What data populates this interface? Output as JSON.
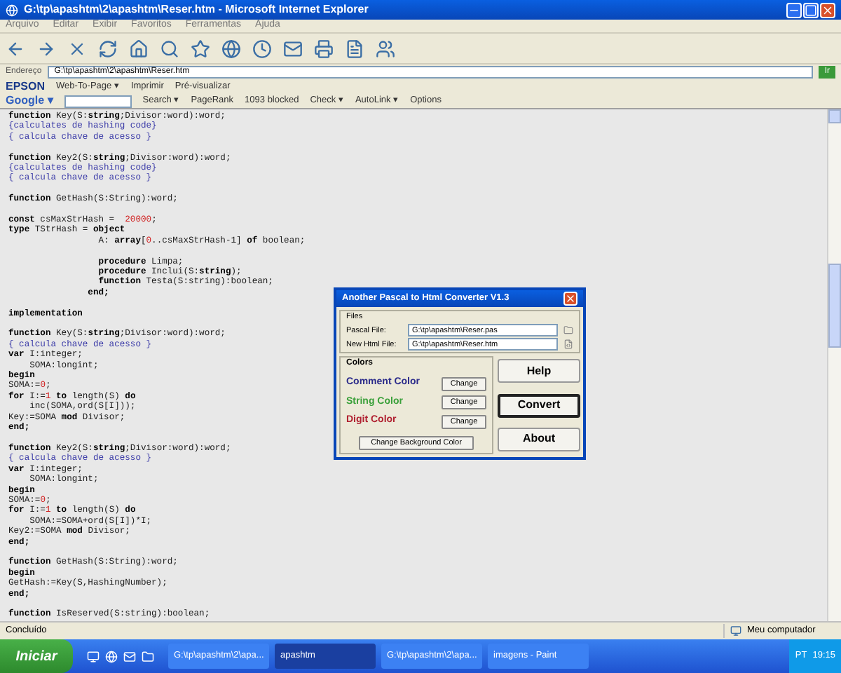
{
  "window": {
    "title": "G:\\tp\\apashtm\\2\\apashtm\\Reser.htm - Microsoft Internet Explorer"
  },
  "menu": [
    "Arquivo",
    "Editar",
    "Exibir",
    "Favoritos",
    "Ferramentas",
    "Ajuda"
  ],
  "address_bar": {
    "label": "Endereço",
    "value": "G:\\tp\\apashtm\\2\\apashtm\\Reser.htm",
    "go": "Ir"
  },
  "epson_bar": {
    "brand": "EPSON",
    "items": [
      "Web-To-Page ▾",
      "Imprimir",
      "Pré-visualizar"
    ]
  },
  "google_bar": {
    "brand": "Google ▾",
    "items": [
      "Search ▾",
      "PageRank",
      "1093 blocked",
      "Check ▾",
      "AutoLink ▾",
      "Options"
    ]
  },
  "code_blocks": [
    [
      [
        {
          "text": "function",
          "kind": "keyword"
        },
        {
          "text": " Key(S:",
          "kind": "code"
        },
        {
          "text": "string",
          "kind": "keyword"
        },
        {
          "text": ";Divisor:word):word;",
          "kind": "code"
        }
      ],
      [
        {
          "text": "{calculates de hashing code}",
          "kind": "comment"
        }
      ],
      [
        {
          "text": "{ calcula chave de acesso }",
          "kind": "comment"
        }
      ]
    ],
    [
      [
        {
          "text": "function",
          "kind": "keyword"
        },
        {
          "text": " Key2(S:",
          "kind": "code"
        },
        {
          "text": "string",
          "kind": "keyword"
        },
        {
          "text": ";Divisor:word):word;",
          "kind": "code"
        }
      ],
      [
        {
          "text": "{calculates de hashing code}",
          "kind": "comment"
        }
      ],
      [
        {
          "text": "{ calcula chave de acesso }",
          "kind": "comment"
        }
      ]
    ],
    [
      [
        {
          "text": "function",
          "kind": "keyword"
        },
        {
          "text": " GetHash(S:String):word;",
          "kind": "code"
        }
      ]
    ],
    [
      [
        {
          "text": "const",
          "kind": "keyword"
        },
        {
          "text": " csMaxStrHash =  ",
          "kind": "code"
        },
        {
          "text": "20000",
          "kind": "number"
        },
        {
          "text": ";",
          "kind": "code"
        }
      ],
      [
        {
          "text": "type",
          "kind": "keyword"
        },
        {
          "text": " TStrHash = ",
          "kind": "code"
        },
        {
          "text": "object",
          "kind": "keyword"
        }
      ],
      [
        {
          "text": "                 A: ",
          "kind": "code"
        },
        {
          "text": "array",
          "kind": "keyword"
        },
        {
          "text": "[",
          "kind": "code"
        },
        {
          "text": "0",
          "kind": "number"
        },
        {
          "text": "..csMaxStrHash-1] ",
          "kind": "code"
        },
        {
          "text": "of",
          "kind": "keyword"
        },
        {
          "text": " boolean;",
          "kind": "code"
        }
      ]
    ],
    [
      [
        {
          "text": "                 procedure",
          "kind": "keyword"
        },
        {
          "text": " Limpa;",
          "kind": "code"
        }
      ],
      [
        {
          "text": "                 procedure",
          "kind": "keyword"
        },
        {
          "text": " Inclui(S:",
          "kind": "code"
        },
        {
          "text": "string",
          "kind": "keyword"
        },
        {
          "text": ");",
          "kind": "code"
        }
      ],
      [
        {
          "text": "                 function",
          "kind": "keyword"
        },
        {
          "text": " Testa(S:string):boolean;",
          "kind": "code"
        }
      ],
      [
        {
          "text": "               end;",
          "kind": "keyword"
        }
      ]
    ],
    [
      [
        {
          "text": "implementation",
          "kind": "keyword"
        }
      ]
    ],
    [
      [
        {
          "text": "function",
          "kind": "keyword"
        },
        {
          "text": " Key(S:",
          "kind": "code"
        },
        {
          "text": "string",
          "kind": "keyword"
        },
        {
          "text": ";Divisor:word):word;",
          "kind": "code"
        }
      ],
      [
        {
          "text": "{ calcula chave de acesso }",
          "kind": "comment"
        }
      ],
      [
        {
          "text": "var",
          "kind": "keyword"
        },
        {
          "text": " I:integer;",
          "kind": "code"
        }
      ],
      [
        {
          "text": "    SOMA:longint;",
          "kind": "code"
        }
      ],
      [
        {
          "text": "begin",
          "kind": "keyword"
        }
      ],
      [
        {
          "text": "SOMA:=",
          "kind": "code"
        },
        {
          "text": "0",
          "kind": "number"
        },
        {
          "text": ";",
          "kind": "code"
        }
      ],
      [
        {
          "text": "for",
          "kind": "keyword"
        },
        {
          "text": " I:=",
          "kind": "code"
        },
        {
          "text": "1",
          "kind": "number"
        },
        {
          "text": " to",
          "kind": "keyword"
        },
        {
          "text": " length(S) ",
          "kind": "code"
        },
        {
          "text": "do",
          "kind": "keyword"
        }
      ],
      [
        {
          "text": "    inc(SOMA,ord(S[I]));",
          "kind": "code"
        }
      ],
      [
        {
          "text": "Key:=SOMA ",
          "kind": "code"
        },
        {
          "text": "mod",
          "kind": "keyword"
        },
        {
          "text": " Divisor;",
          "kind": "code"
        }
      ],
      [
        {
          "text": "end;",
          "kind": "keyword"
        }
      ]
    ],
    [
      [
        {
          "text": "function",
          "kind": "keyword"
        },
        {
          "text": " Key2(S:",
          "kind": "code"
        },
        {
          "text": "string",
          "kind": "keyword"
        },
        {
          "text": ";Divisor:word):word;",
          "kind": "code"
        }
      ],
      [
        {
          "text": "{ calcula chave de acesso }",
          "kind": "comment"
        }
      ],
      [
        {
          "text": "var",
          "kind": "keyword"
        },
        {
          "text": " I:integer;",
          "kind": "code"
        }
      ],
      [
        {
          "text": "    SOMA:longint;",
          "kind": "code"
        }
      ],
      [
        {
          "text": "begin",
          "kind": "keyword"
        }
      ],
      [
        {
          "text": "SOMA:=",
          "kind": "code"
        },
        {
          "text": "0",
          "kind": "number"
        },
        {
          "text": ";",
          "kind": "code"
        }
      ],
      [
        {
          "text": "for",
          "kind": "keyword"
        },
        {
          "text": " I:=",
          "kind": "code"
        },
        {
          "text": "1",
          "kind": "number"
        },
        {
          "text": " to",
          "kind": "keyword"
        },
        {
          "text": " length(S) ",
          "kind": "code"
        },
        {
          "text": "do",
          "kind": "keyword"
        }
      ],
      [
        {
          "text": "    SOMA:=SOMA+ord(S[I])*I;",
          "kind": "code"
        }
      ],
      [
        {
          "text": "Key2:=SOMA ",
          "kind": "code"
        },
        {
          "text": "mod",
          "kind": "keyword"
        },
        {
          "text": " Divisor;",
          "kind": "code"
        }
      ],
      [
        {
          "text": "end;",
          "kind": "keyword"
        }
      ]
    ],
    [
      [
        {
          "text": "function",
          "kind": "keyword"
        },
        {
          "text": " GetHash(S:String):word;",
          "kind": "code"
        }
      ],
      [
        {
          "text": "begin",
          "kind": "keyword"
        }
      ],
      [
        {
          "text": "GetHash:=Key(S,HashingNumber);",
          "kind": "code"
        }
      ],
      [
        {
          "text": "end;",
          "kind": "keyword"
        }
      ]
    ],
    [
      [
        {
          "text": "function",
          "kind": "keyword"
        },
        {
          "text": " IsReserved(S:string):boolean;",
          "kind": "code"
        }
      ]
    ]
  ],
  "dialog": {
    "title": "Another Pascal to Html Converter V1.3",
    "files": {
      "label": "Files",
      "rows": [
        {
          "label": "Pascal File:",
          "value": "G:\\tp\\apashtm\\Reser.pas"
        },
        {
          "label": "New Html File:",
          "value": "G:\\tp\\apashtm\\Reser.htm"
        }
      ]
    },
    "colors": {
      "label": "Colors",
      "items": [
        {
          "label": "Comment Color",
          "color": "#2a2a8a",
          "button": "Change"
        },
        {
          "label": "String Color",
          "color": "#3aa03a",
          "button": "Change"
        },
        {
          "label": "Digit Color",
          "color": "#b02030",
          "button": "Change"
        }
      ],
      "background_button": "Change Background Color"
    },
    "buttons": [
      {
        "label": "Help",
        "selected": false
      },
      {
        "label": "Convert",
        "selected": true
      },
      {
        "label": "About",
        "selected": false
      }
    ]
  },
  "status_bar": {
    "text": "Concluído",
    "zone": "Meu computador"
  },
  "taskbar": {
    "start": "Iniciar",
    "tasks": [
      {
        "label": "G:\\tp\\apashtm\\2\\apa...",
        "selected": false
      },
      {
        "label": "apashtm",
        "selected": true
      },
      {
        "label": "G:\\tp\\apashtm\\2\\apa...",
        "selected": false
      },
      {
        "label": "imagens - Paint",
        "selected": false
      }
    ],
    "language": "PT",
    "clock": "19:15"
  }
}
